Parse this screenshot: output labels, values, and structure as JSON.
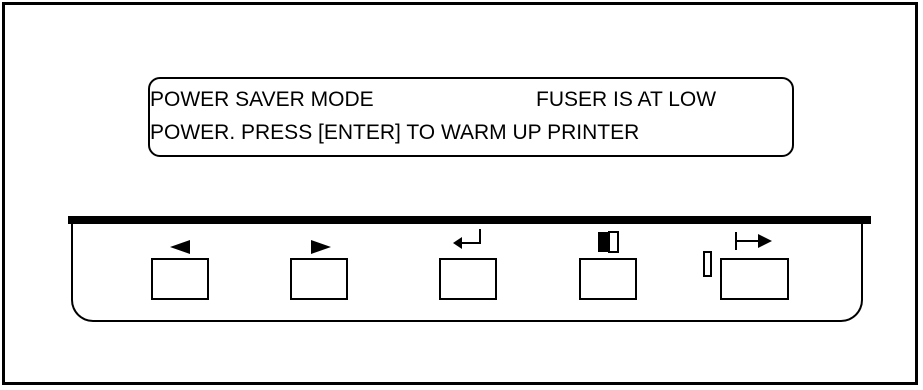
{
  "display": {
    "line1_left": "POWER SAVER MODE",
    "line1_right": "FUSER IS AT LOW",
    "line2": "POWER. PRESS [ENTER] TO WARM UP PRINTER"
  },
  "keys": [
    {
      "icon": "left-arrow-icon"
    },
    {
      "icon": "right-arrow-icon"
    },
    {
      "icon": "enter-icon"
    },
    {
      "icon": "menu-icon"
    },
    {
      "icon": "online-icon"
    }
  ],
  "colors": {
    "outline": "#000000",
    "background": "#ffffff"
  }
}
